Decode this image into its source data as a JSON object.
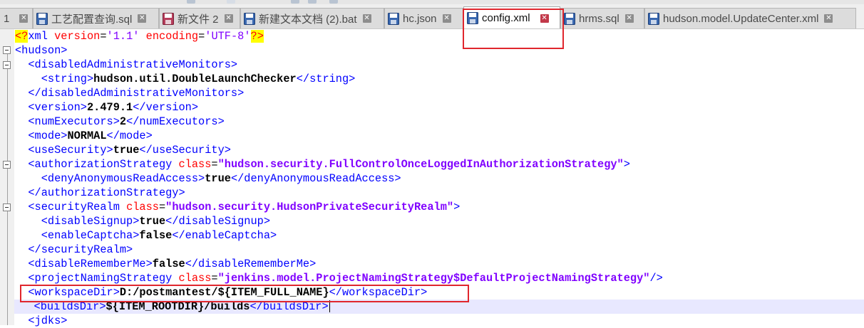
{
  "tabs": [
    {
      "label": "1",
      "active": false
    },
    {
      "label": "工艺配置查询.sql",
      "active": false
    },
    {
      "label": "新文件 2",
      "active": false
    },
    {
      "label": "新建文本文档 (2).bat",
      "active": false
    },
    {
      "label": "hc.json",
      "active": false
    },
    {
      "label": "config.xml",
      "active": true
    },
    {
      "label": "hrms.sql",
      "active": false
    },
    {
      "label": "hudson.model.UpdateCenter.xml",
      "active": false
    }
  ],
  "icons": {
    "tab_file": "floppy-disk-icon",
    "tab_close": "close-icon",
    "fold": "fold-collapse-icon"
  },
  "colors": {
    "tag": "#0000ff",
    "text": "#000000",
    "attribute": "#ff0000",
    "attribute_value": "#8000ff",
    "annotation": "#e0262d",
    "caret_line": "#e8e8ff"
  },
  "code": {
    "l1": {
      "open": "<?",
      "name": "xml",
      "a1": "version",
      "v1": "'1.1'",
      "a2": "encoding",
      "v2": "'UTF-8'",
      "close": "?>"
    },
    "l2": {
      "open": "<hudson>"
    },
    "l3": {
      "open": "<disabledAdministrativeMonitors>"
    },
    "l4": {
      "open": "<string>",
      "text": "hudson.util.DoubleLaunchChecker",
      "close": "</string>"
    },
    "l5": {
      "close": "</disabledAdministrativeMonitors>"
    },
    "l6": {
      "open": "<version>",
      "text": "2.479.1",
      "close": "</version>"
    },
    "l7": {
      "open": "<numExecutors>",
      "text": "2",
      "close": "</numExecutors>"
    },
    "l8": {
      "open": "<mode>",
      "text": "NORMAL",
      "close": "</mode>"
    },
    "l9": {
      "open": "<useSecurity>",
      "text": "true",
      "close": "</useSecurity>"
    },
    "l10": {
      "open": "<authorizationStrategy",
      "attr": "class",
      "val": "\"hudson.security.FullControlOnceLoggedInAuthorizationStrategy\"",
      "close": ">"
    },
    "l11": {
      "open": "<denyAnonymousReadAccess>",
      "text": "true",
      "close": "</denyAnonymousReadAccess>"
    },
    "l12": {
      "close": "</authorizationStrategy>"
    },
    "l13": {
      "open": "<securityRealm",
      "attr": "class",
      "val": "\"hudson.security.HudsonPrivateSecurityRealm\"",
      "close": ">"
    },
    "l14": {
      "open": "<disableSignup>",
      "text": "true",
      "close": "</disableSignup>"
    },
    "l15": {
      "open": "<enableCaptcha>",
      "text": "false",
      "close": "</enableCaptcha>"
    },
    "l16": {
      "close": "</securityRealm>"
    },
    "l17": {
      "open": "<disableRememberMe>",
      "text": "false",
      "close": "</disableRememberMe>"
    },
    "l18": {
      "open": "<projectNamingStrategy",
      "attr": "class",
      "val": "\"jenkins.model.ProjectNamingStrategy$DefaultProjectNamingStrategy\"",
      "close": "/>"
    },
    "l19": {
      "open": "<workspaceDir>",
      "text": "D:/postmantest/${ITEM_FULL_NAME}",
      "close": "</workspaceDir>"
    },
    "l20": {
      "open": "<buildsDir>",
      "text": "${ITEM_ROOTDIR}/builds",
      "close": "</buildsDir>"
    },
    "l21": {
      "open": "<jdks>"
    }
  }
}
